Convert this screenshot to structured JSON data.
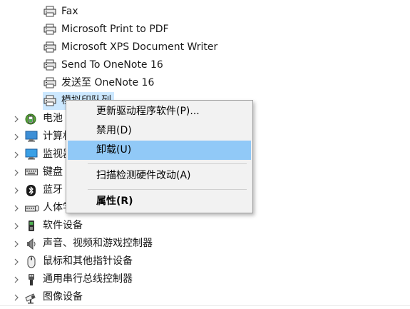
{
  "printers": [
    {
      "label": "Fax"
    },
    {
      "label": "Microsoft Print to PDF"
    },
    {
      "label": "Microsoft XPS Document Writer"
    },
    {
      "label": "Send To OneNote 16"
    },
    {
      "label": "发送至 OneNote 16"
    },
    {
      "label": "模拟印队列"
    }
  ],
  "categories": [
    {
      "label": "电池",
      "icon": "battery-icon"
    },
    {
      "label": "计算机",
      "icon": "computer-icon"
    },
    {
      "label": "监视器",
      "icon": "monitor-icon"
    },
    {
      "label": "键盘",
      "icon": "keyboard-icon"
    },
    {
      "label": "蓝牙",
      "icon": "bluetooth-icon"
    },
    {
      "label": "人体学输入设备",
      "icon": "hid-icon"
    },
    {
      "label": "软件设备",
      "icon": "software-device-icon"
    },
    {
      "label": "声音、视频和游戏控制器",
      "icon": "speaker-icon"
    },
    {
      "label": "鼠标和其他指针设备",
      "icon": "mouse-icon"
    },
    {
      "label": "通用串行总线控制器",
      "icon": "usb-icon"
    },
    {
      "label": "图像设备",
      "icon": "camera-icon"
    }
  ],
  "context_menu": {
    "update_driver": "更新驱动程序软件(P)...",
    "disable": "禁用(D)",
    "uninstall": "卸载(U)",
    "scan": "扫描检测硬件改动(A)",
    "properties": "属性(R)"
  },
  "colors": {
    "menu_bg": "#f2f2f2",
    "menu_hover": "#91c9f7",
    "selected_row": "#cce8ff"
  }
}
